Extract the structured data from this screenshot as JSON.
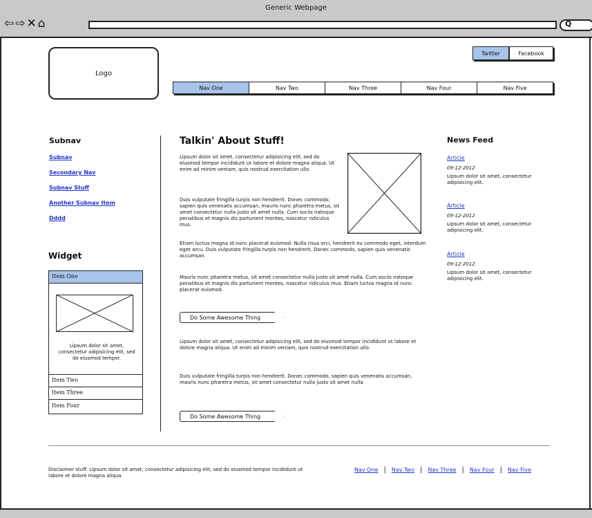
{
  "window": {
    "title": "Generic Webpage",
    "nav_glyphs": "⇦⇨✕⌂",
    "search_glyph": "Q"
  },
  "header": {
    "logo": "Logo",
    "social": [
      "Twitter",
      "Facebook"
    ],
    "nav": [
      "Nav One",
      "Nav Two",
      "Nav Three",
      "Nav Four",
      "Nav Five"
    ]
  },
  "subnav": {
    "title": "Subnav",
    "items": [
      "Subnav",
      "Secondary Nav",
      "Subnav Stuff",
      "Another Subnav Item",
      "Dddd"
    ]
  },
  "widget": {
    "title": "Widget",
    "items": [
      "Item One",
      "Item Two",
      "Item Three",
      "Item Four"
    ],
    "body_text": "Lipsum dolor sit amet, consectetur adipisicing elit, sed do eiusmod tempor."
  },
  "main": {
    "heading": "Talkin' About Stuff!",
    "para1": "Lipsum dolor sit amet, consectetur adipisicing elit, sed do eiusmod tempor incididunt ut labore et dolore magna aliqua. Ut enim ad minim veniam, quis nostrud exercitation ullo.",
    "para2": "Duis vulputate fringilla turpis non hendrerit. Donec commodo, sapien quis venenatis accumsan, mauris nunc pharetra metus, sit amet consectetur nulla justo sit amet nulla. Cum sociis natoque penatibus et magnis dis parturient montes, nascetur ridiculus mus.",
    "para2b": "Etiam luctus magna id nunc placerat euismod. Nulla risus orci, hendrerit eu commodo eget, interdum eget arcu. Duis vulputate fringilla turpis non hendrerit. Donec commodo, sapien quis venenatis accumsan.",
    "para3": "Mauris nunc pharetra metus, sit amet consectetur nulla justo sit amet nulla. Cum sociis natoque penatibus et magnis dis parturient montes, nascetur ridiculus mus. Etiam luctus magna id nunc placerat euismod.",
    "button1": "Do Some Awesome Thing",
    "para4": "Lipsum dolor sit amet, consectetur adipisicing elit, sed do eiusmod tempor incididunt ut labore et dolore magna aliqua. Ut enim ad minim veniam, quis nostrud exercitation ullo.",
    "para5": "Duis vulputate fringilla turpis non hendrerit. Donec commodo, sapien quis venenatis accumsan, mauris nunc pharetra metus, sit amet consectetur nulla justo sit amet nulla.",
    "button2": "Do Some Awesome Thing"
  },
  "news": {
    "title": "News Feed",
    "items": [
      {
        "link": "Article",
        "date": "09-12-2012",
        "text": "Lipsum dolor sit amet, consectetur adipisicing elit."
      },
      {
        "link": "Article",
        "date": "09-12-2012",
        "text": "Lipsum dolor sit amet, consectetur adipisicing elit."
      },
      {
        "link": "Article",
        "date": "09-12-2012",
        "text": "Lipsum dolor sit amet, consectetur adipisicing elit."
      }
    ]
  },
  "footer": {
    "disclaimer": "Disclaimer stuff. Lipsum dolor sit amet, consectetur adipisicing elit, sed do eiusmod tempor incididunt ut labore et dolore magna aliqua.",
    "links": [
      "Nav One",
      "Nav Two",
      "Nav Three",
      "Nav Four",
      "Nav Five"
    ],
    "separator": "|"
  },
  "colors": {
    "active_blue": "#a8c4ea",
    "link_blue": "#2233cc",
    "chrome_gray": "#c9c9c9"
  }
}
